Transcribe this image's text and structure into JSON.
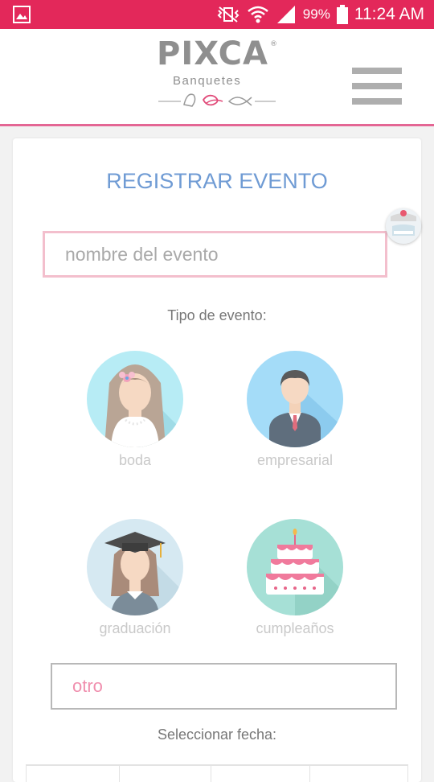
{
  "status_bar": {
    "battery": "99%",
    "time": "11:24 AM",
    "color": "#e3285a",
    "icons": [
      "gallery-icon",
      "vibrate-icon",
      "wifi-icon",
      "signal-icon",
      "battery-icon"
    ]
  },
  "header": {
    "logo_title": "PIXCA",
    "logo_reg": "®",
    "logo_sub": "Banquetes",
    "menu_icon": "hamburger-menu-icon"
  },
  "form": {
    "title": "REGISTRAR EVENTO",
    "name_placeholder": "nombre del evento",
    "tipo_label": "Tipo de evento:",
    "event_types": [
      {
        "label": "boda",
        "icon": "bride-icon"
      },
      {
        "label": "empresarial",
        "icon": "businessman-icon"
      },
      {
        "label": "graduación",
        "icon": "graduate-icon"
      },
      {
        "label": "cumpleaños",
        "icon": "birthday-cake-icon"
      }
    ],
    "otro_placeholder": "otro",
    "fecha_label": "Seleccionar fecha:"
  },
  "colors": {
    "title": "#6f9bd4",
    "accent_pink": "#e46694",
    "placeholder_pink": "#f08fae"
  }
}
